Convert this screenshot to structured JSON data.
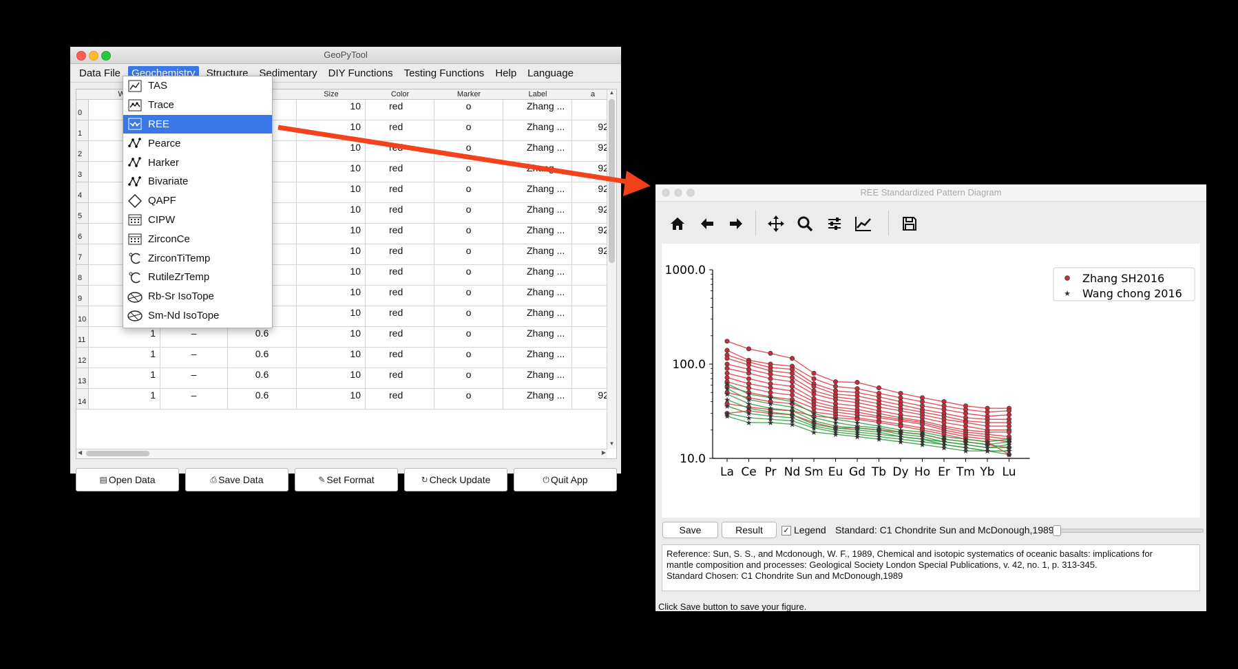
{
  "main_window": {
    "title": "GeoPyTool",
    "menu": [
      "Data File",
      "Geochemistry",
      "Structure",
      "Sedimentary",
      "DIY Functions",
      "Testing Functions",
      "Help",
      "Language"
    ],
    "columns": [
      "Wid",
      "",
      "",
      "Size",
      "Color",
      "Marker",
      "Label",
      "a"
    ],
    "rows": [
      {
        "idx": "0",
        "c0": "1",
        "c1": "",
        "c2": "",
        "size": "10",
        "color": "red",
        "marker": "o",
        "label": "Zhang ...",
        "extra": ""
      },
      {
        "idx": "1",
        "c0": "1",
        "c1": "",
        "c2": "",
        "size": "10",
        "color": "red",
        "marker": "o",
        "label": "Zhang ...",
        "extra": "92"
      },
      {
        "idx": "2",
        "c0": "1",
        "c1": "",
        "c2": "",
        "size": "10",
        "color": "red",
        "marker": "o",
        "label": "Zhang ...",
        "extra": "92"
      },
      {
        "idx": "3",
        "c0": "1",
        "c1": "",
        "c2": "",
        "size": "10",
        "color": "red",
        "marker": "o",
        "label": "Zhang ...",
        "extra": "92"
      },
      {
        "idx": "4",
        "c0": "1",
        "c1": "",
        "c2": "",
        "size": "10",
        "color": "red",
        "marker": "o",
        "label": "Zhang ...",
        "extra": "92"
      },
      {
        "idx": "5",
        "c0": "1",
        "c1": "",
        "c2": "",
        "size": "10",
        "color": "red",
        "marker": "o",
        "label": "Zhang ...",
        "extra": "92"
      },
      {
        "idx": "6",
        "c0": "1",
        "c1": "",
        "c2": "",
        "size": "10",
        "color": "red",
        "marker": "o",
        "label": "Zhang ...",
        "extra": "92"
      },
      {
        "idx": "7",
        "c0": "1",
        "c1": "",
        "c2": "",
        "size": "10",
        "color": "red",
        "marker": "o",
        "label": "Zhang ...",
        "extra": "92"
      },
      {
        "idx": "8",
        "c0": "1",
        "c1": "",
        "c2": "",
        "size": "10",
        "color": "red",
        "marker": "o",
        "label": "Zhang ...",
        "extra": ""
      },
      {
        "idx": "9",
        "c0": "1",
        "c1": "",
        "c2": "",
        "size": "10",
        "color": "red",
        "marker": "o",
        "label": "Zhang ...",
        "extra": ""
      },
      {
        "idx": "10",
        "c0": "1",
        "c1": "",
        "c2": "",
        "size": "10",
        "color": "red",
        "marker": "o",
        "label": "Zhang ...",
        "extra": ""
      },
      {
        "idx": "11",
        "c0": "1",
        "c1": "–",
        "c2": "0.6",
        "size": "10",
        "color": "red",
        "marker": "o",
        "label": "Zhang ...",
        "extra": ""
      },
      {
        "idx": "12",
        "c0": "1",
        "c1": "–",
        "c2": "0.6",
        "size": "10",
        "color": "red",
        "marker": "o",
        "label": "Zhang ...",
        "extra": ""
      },
      {
        "idx": "13",
        "c0": "1",
        "c1": "–",
        "c2": "0.6",
        "size": "10",
        "color": "red",
        "marker": "o",
        "label": "Zhang ...",
        "extra": ""
      },
      {
        "idx": "14",
        "c0": "1",
        "c1": "–",
        "c2": "0.6",
        "size": "10",
        "color": "red",
        "marker": "o",
        "label": "Zhang ...",
        "extra": "92"
      }
    ],
    "buttons": [
      "Open Data",
      "Save Data",
      "Set Format",
      "Check Update",
      "Quit App"
    ],
    "geochem_menu": [
      {
        "label": "TAS",
        "icon": "line-chart-icon"
      },
      {
        "label": "Trace",
        "icon": "trace-icon"
      },
      {
        "label": "REE",
        "icon": "ree-icon"
      },
      {
        "label": "Pearce",
        "icon": "zigzag-icon"
      },
      {
        "label": "Harker",
        "icon": "zigzag-icon"
      },
      {
        "label": "Bivariate",
        "icon": "zigzag-icon"
      },
      {
        "label": "QAPF",
        "icon": "diamond-icon"
      },
      {
        "label": "CIPW",
        "icon": "calendar-icon"
      },
      {
        "label": "ZirconCe",
        "icon": "calendar-icon"
      },
      {
        "label": "ZirconTiTemp",
        "icon": "celsius-icon"
      },
      {
        "label": "RutileZrTemp",
        "icon": "celsius-icon"
      },
      {
        "label": "Rb-Sr IsoTope",
        "icon": "isotope-icon"
      },
      {
        "label": "Sm-Nd IsoTope",
        "icon": "isotope-icon"
      }
    ],
    "selected_menu_item": "REE"
  },
  "ree_window": {
    "title": "REE Standardized Pattern Diagram",
    "toolbar": [
      "home-icon",
      "back-arrow-icon",
      "forward-arrow-icon",
      "pan-icon",
      "zoom-icon",
      "configure-icon",
      "edit-curves-icon",
      "save-icon"
    ],
    "save_label": "Save",
    "result_label": "Result",
    "legend_label": "Legend",
    "legend_checked": true,
    "standard_text": "Standard: C1 Chondrite Sun and McDonough,1989",
    "reference_lines": [
      "Reference: Sun, S. S., and Mcdonough, W. F., 1989, Chemical and isotopic systematics of oceanic basalts: implications for",
      "mantle composition and processes: Geological Society London Special Publications, v. 42, no. 1, p. 313-345.",
      "Standard Chosen: C1 Chondrite Sun and McDonough,1989"
    ],
    "status": "Click Save button to save your figure."
  },
  "chart_data": {
    "type": "line",
    "yscale": "log",
    "ylim": [
      10,
      1000
    ],
    "yticks": [
      "1000.0",
      "100.0",
      "10.0"
    ],
    "categories": [
      "La",
      "Ce",
      "Pr",
      "Nd",
      "Sm",
      "Eu",
      "Gd",
      "Tb",
      "Dy",
      "Ho",
      "Er",
      "Tm",
      "Yb",
      "Lu"
    ],
    "legend": [
      {
        "name": "Zhang SH2016",
        "marker": "circle",
        "color": "#d6333a"
      },
      {
        "name": "Wang chong 2016",
        "marker": "star",
        "color": "#333333"
      }
    ],
    "legend_position": "top-right",
    "series": [
      {
        "group": "Zhang SH2016",
        "color": "#e0353c",
        "values": [
          175,
          145,
          130,
          115,
          80,
          65,
          64,
          56,
          49,
          44,
          40,
          36,
          34,
          34
        ]
      },
      {
        "group": "Zhang SH2016",
        "color": "#e0353c",
        "values": [
          140,
          110,
          100,
          95,
          70,
          58,
          55,
          49,
          44,
          40,
          36,
          33,
          31,
          32
        ]
      },
      {
        "group": "Zhang SH2016",
        "color": "#e0353c",
        "values": [
          125,
          105,
          92,
          88,
          62,
          52,
          50,
          45,
          40,
          36,
          33,
          30,
          28,
          29
        ]
      },
      {
        "group": "Zhang SH2016",
        "color": "#e0353c",
        "values": [
          115,
          98,
          85,
          80,
          58,
          48,
          46,
          41,
          37,
          33,
          30,
          27,
          26,
          26
        ]
      },
      {
        "group": "Zhang SH2016",
        "color": "#e0353c",
        "values": [
          100,
          88,
          78,
          72,
          52,
          45,
          42,
          38,
          34,
          31,
          28,
          25,
          24,
          24
        ]
      },
      {
        "group": "Zhang SH2016",
        "color": "#e0353c",
        "values": [
          90,
          80,
          70,
          65,
          48,
          42,
          39,
          35,
          32,
          29,
          26,
          24,
          22,
          22
        ]
      },
      {
        "group": "Zhang SH2016",
        "color": "#e0353c",
        "values": [
          80,
          70,
          62,
          58,
          43,
          38,
          36,
          32,
          29,
          27,
          24,
          22,
          20,
          20
        ]
      },
      {
        "group": "Zhang SH2016",
        "color": "#e0353c",
        "values": [
          72,
          62,
          56,
          52,
          40,
          35,
          33,
          30,
          27,
          25,
          22,
          20,
          19,
          19
        ]
      },
      {
        "group": "Zhang SH2016",
        "color": "#e0353c",
        "values": [
          65,
          56,
          50,
          47,
          37,
          33,
          31,
          28,
          26,
          24,
          21,
          19,
          18,
          17
        ]
      },
      {
        "group": "Zhang SH2016",
        "color": "#e0353c",
        "values": [
          58,
          50,
          45,
          42,
          34,
          31,
          29,
          27,
          25,
          23,
          20,
          18,
          17,
          16
        ]
      },
      {
        "group": "Zhang SH2016",
        "color": "#e0353c",
        "values": [
          50,
          44,
          40,
          38,
          31,
          29,
          27,
          25,
          23,
          21,
          19,
          17,
          16,
          15
        ]
      },
      {
        "group": "Zhang SH2016",
        "color": "#e0353c",
        "values": [
          38,
          35,
          33,
          32,
          28,
          27,
          26,
          24,
          22,
          20,
          18,
          16,
          15,
          11
        ]
      },
      {
        "group": "Zhang SH2016",
        "color": "#e0353c",
        "values": [
          30,
          32,
          30,
          29,
          24,
          21,
          21,
          20,
          19,
          18,
          16,
          15,
          14,
          13
        ]
      },
      {
        "group": "Wang chong 2016",
        "color": "#2e9b3a",
        "values": [
          62,
          48,
          44,
          40,
          30,
          26,
          24,
          22,
          20,
          19,
          17,
          16,
          15,
          16
        ]
      },
      {
        "group": "Wang chong 2016",
        "color": "#2e9b3a",
        "values": [
          55,
          42,
          38,
          35,
          27,
          24,
          22,
          21,
          19,
          18,
          16,
          15,
          14,
          15
        ]
      },
      {
        "group": "Wang chong 2016",
        "color": "#2e9b3a",
        "values": [
          48,
          38,
          34,
          32,
          25,
          22,
          21,
          20,
          18,
          17,
          15,
          14,
          13,
          14
        ]
      },
      {
        "group": "Wang chong 2016",
        "color": "#2e9b3a",
        "values": [
          42,
          34,
          31,
          29,
          23,
          21,
          20,
          19,
          17,
          16,
          15,
          14,
          13,
          13
        ]
      },
      {
        "group": "Wang chong 2016",
        "color": "#2e9b3a",
        "values": [
          36,
          30,
          28,
          27,
          22,
          20,
          19,
          18,
          17,
          16,
          14,
          13,
          12,
          12
        ]
      },
      {
        "group": "Wang chong 2016",
        "color": "#2e9b3a",
        "values": [
          30,
          27,
          26,
          25,
          21,
          19,
          18,
          17,
          16,
          15,
          14,
          13,
          12,
          12
        ]
      },
      {
        "group": "Wang chong 2016",
        "color": "#2e9b3a",
        "values": [
          28,
          24,
          24,
          23,
          19,
          18,
          17,
          16,
          15,
          14,
          13,
          12,
          12,
          11
        ]
      }
    ]
  }
}
